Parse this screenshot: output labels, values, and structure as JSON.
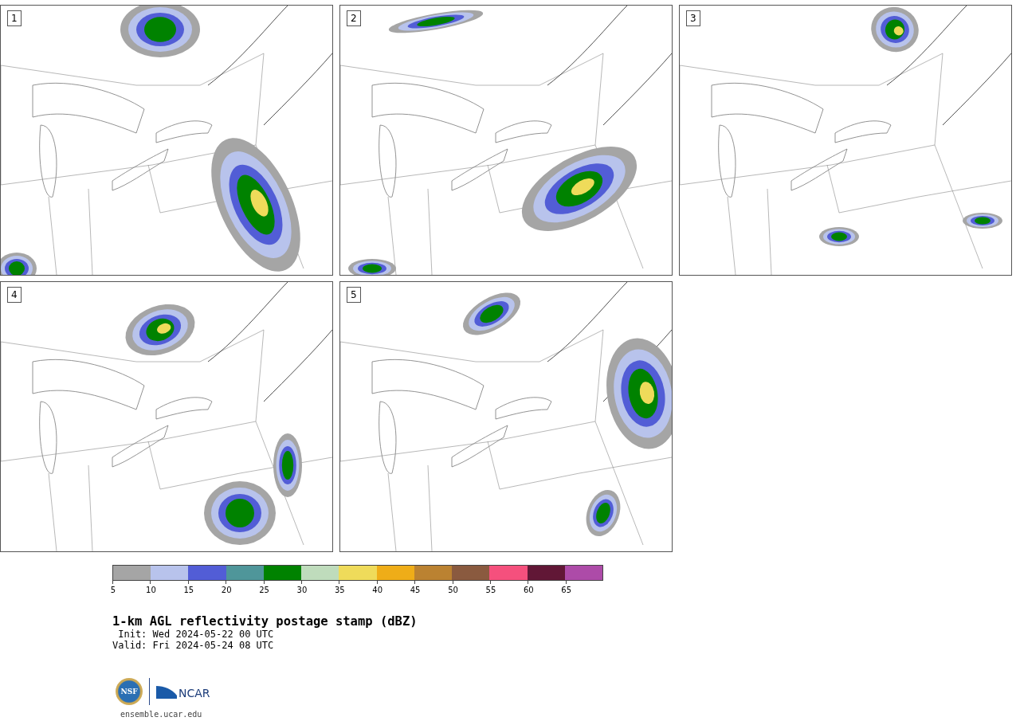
{
  "panels": [
    {
      "number": "1"
    },
    {
      "number": "2"
    },
    {
      "number": "3"
    },
    {
      "number": "4"
    },
    {
      "number": "5"
    }
  ],
  "colorbar": {
    "segments": [
      {
        "label": "5",
        "color": "#a5a5a5"
      },
      {
        "label": "10",
        "color": "#b8c3ec"
      },
      {
        "label": "15",
        "color": "#525dd6"
      },
      {
        "label": "20",
        "color": "#4f969a"
      },
      {
        "label": "25",
        "color": "#008200"
      },
      {
        "label": "30",
        "color": "#bfdcbc"
      },
      {
        "label": "35",
        "color": "#efdb5a"
      },
      {
        "label": "40",
        "color": "#efad18"
      },
      {
        "label": "45",
        "color": "#bb8231"
      },
      {
        "label": "50",
        "color": "#8a5a3f"
      },
      {
        "label": "55",
        "color": "#f5507d"
      },
      {
        "label": "60",
        "color": "#611736"
      },
      {
        "label": "65",
        "color": "#ad4ba8"
      }
    ]
  },
  "caption": {
    "title": "1-km AGL reflectivity postage stamp (dBZ)",
    "init": " Init: Wed 2024-05-22 00 UTC",
    "valid": "Valid: Fri 2024-05-24 08 UTC"
  },
  "logos": {
    "nsf": "NSF",
    "ncar": "NCAR"
  },
  "footer": "ensemble.ucar.edu"
}
